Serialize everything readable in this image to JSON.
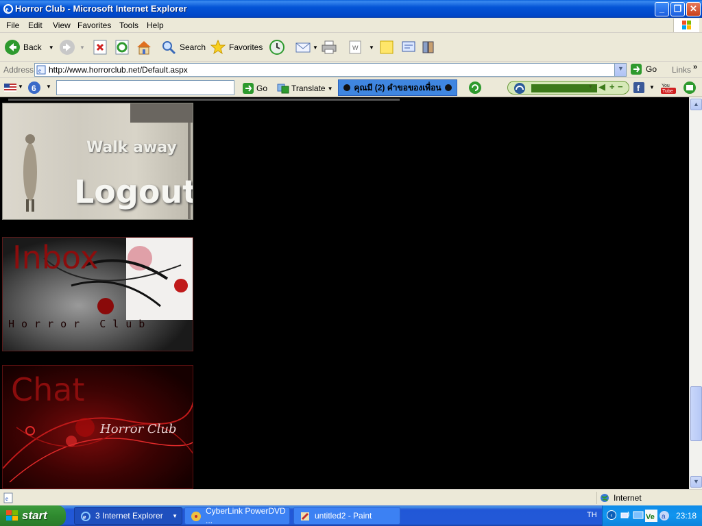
{
  "window": {
    "title": "Horror Club - Microsoft Internet Explorer",
    "min": "_",
    "max": "❐",
    "close": "✕"
  },
  "menu": [
    "File",
    "Edit",
    "View",
    "Favorites",
    "Tools",
    "Help"
  ],
  "toolbar": {
    "back": "Back",
    "search": "Search",
    "favorites": "Favorites"
  },
  "address": {
    "label": "Address",
    "url": "http://www.horrorclub.net/Default.aspx",
    "go": "Go",
    "links": "Links"
  },
  "extrabar": {
    "go": "Go",
    "translate": "Translate",
    "notification": "คุณมี (2) คำขอของเพื่อน"
  },
  "content": {
    "logout_banner": {
      "line1": "Walk away",
      "line2": "Logout"
    },
    "inbox_banner": {
      "title": "Inbox",
      "subtitle": "Horror Club"
    },
    "chat_banner": {
      "title": "Chat",
      "subtitle": "Horror Club"
    }
  },
  "statusbar": {
    "zone": "Internet"
  },
  "taskbar": {
    "start": "start",
    "items": [
      {
        "label": "3 Internet Explorer",
        "active": true
      },
      {
        "label": "CyberLink PowerDVD ...",
        "active": false
      },
      {
        "label": "untitled2 - Paint",
        "active": false
      }
    ],
    "lang": "TH",
    "time": "23:18"
  }
}
